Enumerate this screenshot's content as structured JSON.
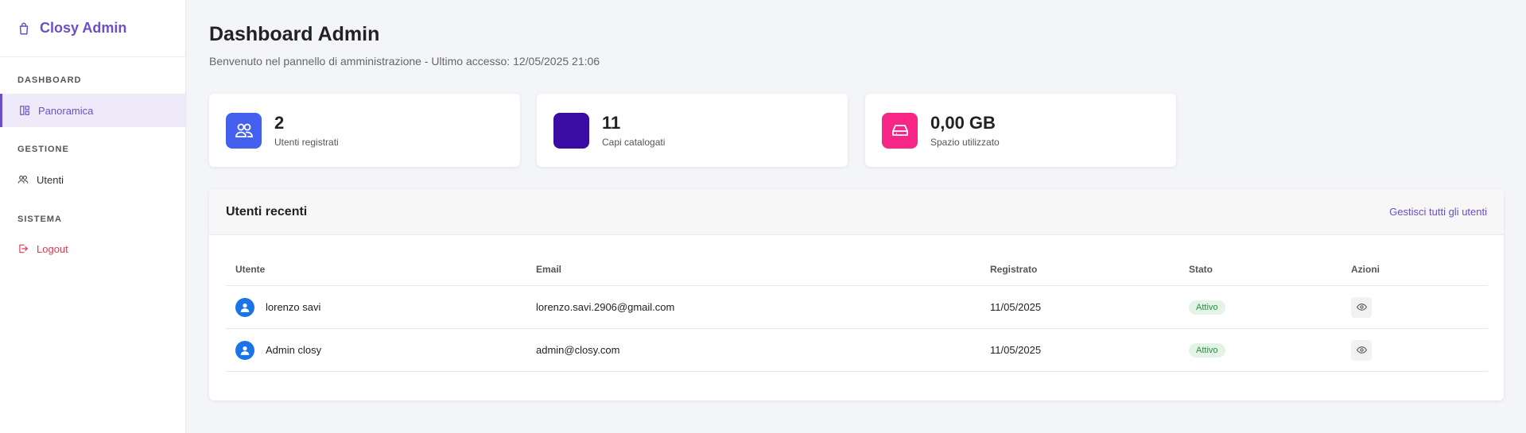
{
  "sidebar": {
    "brand": "Closy Admin",
    "sections": [
      {
        "label": "DASHBOARD",
        "items": [
          {
            "label": "Panoramica"
          }
        ]
      },
      {
        "label": "GESTIONE",
        "items": [
          {
            "label": "Utenti"
          }
        ]
      },
      {
        "label": "SISTEMA",
        "items": [
          {
            "label": "Logout"
          }
        ]
      }
    ]
  },
  "header": {
    "title": "Dashboard Admin",
    "subtitle": "Benvenuto nel pannello di amministrazione - Ultimo accesso: 12/05/2025 21:06"
  },
  "stats": [
    {
      "value": "2",
      "label": "Utenti registrati",
      "color": "#4361ee",
      "icon": "users-icon"
    },
    {
      "value": "11",
      "label": "Capi catalogati",
      "color": "#3a0ca3",
      "icon": "hanger-icon"
    },
    {
      "value": "0,00 GB",
      "label": "Spazio utilizzato",
      "color": "#f72585",
      "icon": "hard-drive-icon"
    }
  ],
  "recent_users": {
    "title": "Utenti recenti",
    "manage_link": "Gestisci tutti gli utenti",
    "columns": [
      "Utente",
      "Email",
      "Registrato",
      "Stato",
      "Azioni"
    ],
    "rows": [
      {
        "name": "lorenzo savi",
        "email": "lorenzo.savi.2906@gmail.com",
        "registered": "11/05/2025",
        "status": "Attivo"
      },
      {
        "name": "Admin closy",
        "email": "admin@closy.com",
        "registered": "11/05/2025",
        "status": "Attivo"
      }
    ]
  },
  "colors": {
    "accent": "#6a4fc8",
    "danger": "#e0364f",
    "success": "#2e8b47"
  }
}
